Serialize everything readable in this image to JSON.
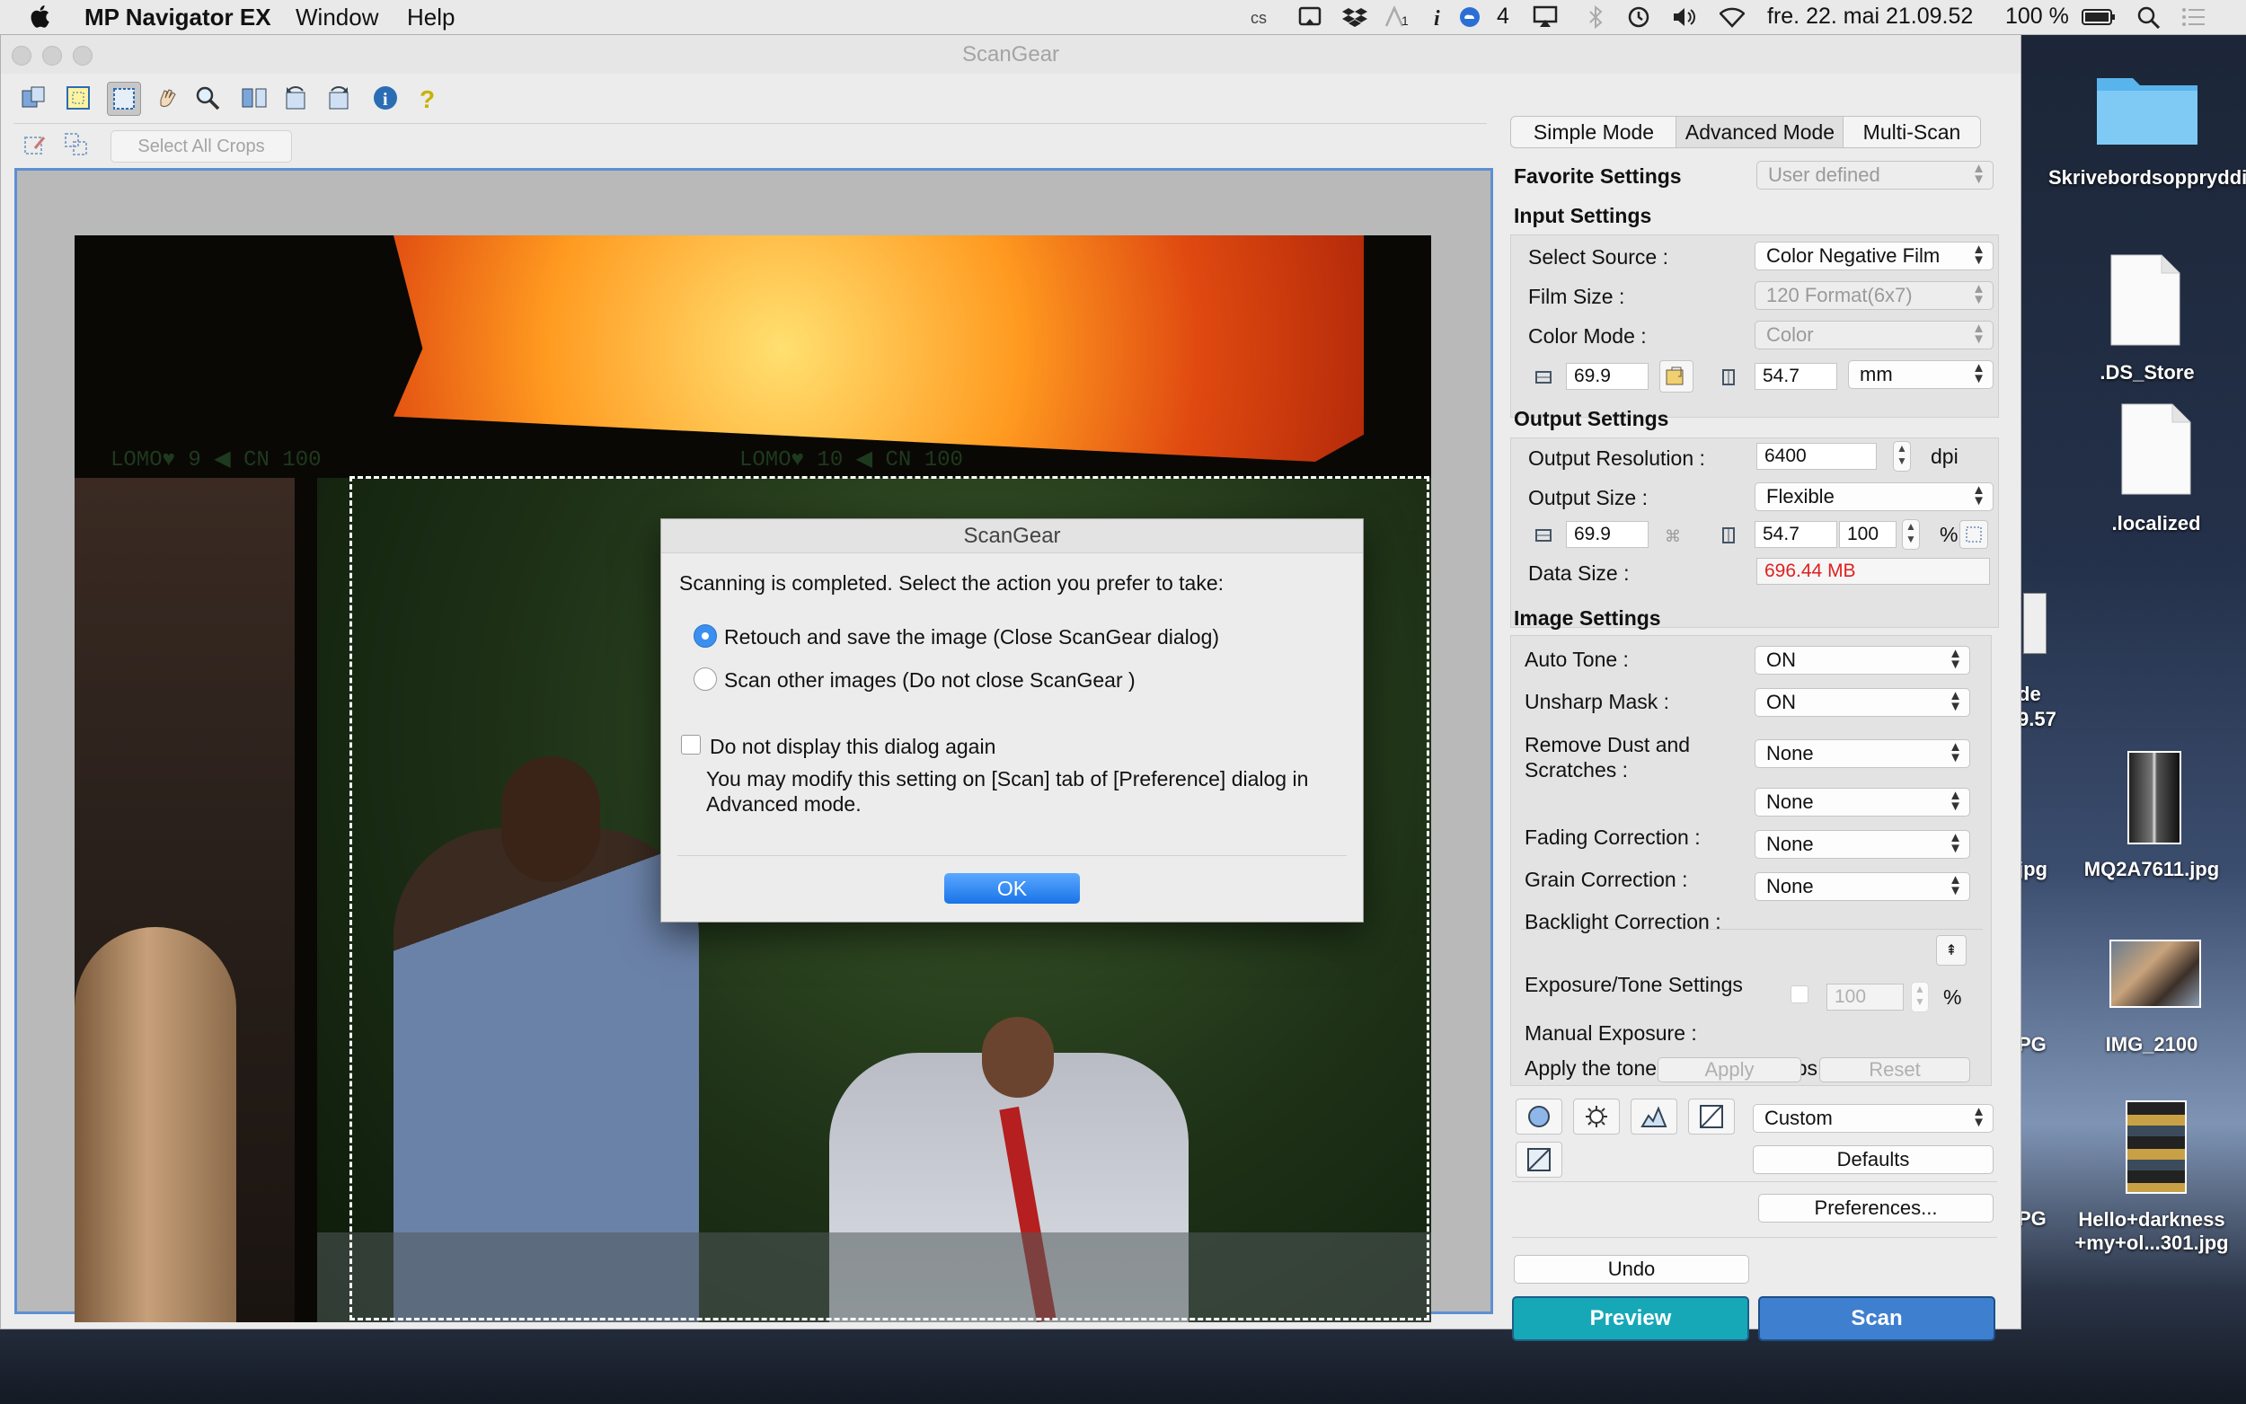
{
  "menubar": {
    "app_name": "MP Navigator EX",
    "menu_window": "Window",
    "menu_help": "Help",
    "cc_badge": "4",
    "date_time": "fre. 22. mai  21.09.52",
    "battery": "100 %"
  },
  "window": {
    "title": "ScanGear"
  },
  "toolbar": {
    "select_all_crops": "Select All Crops"
  },
  "film_edge_text": {
    "left": "LOMO♥    9   ◀  CN 100",
    "right": "LOMO♥  10   ◀  CN 100"
  },
  "modes": {
    "simple": "Simple Mode",
    "advanced": "Advanced Mode",
    "multi": "Multi-Scan"
  },
  "favorite": {
    "label": "Favorite Settings",
    "value": "User defined"
  },
  "input_settings": {
    "heading": "Input Settings",
    "select_source_label": "Select Source :",
    "select_source_value": "Color Negative Film",
    "film_size_label": "Film Size :",
    "film_size_value": "120 Format(6x7)",
    "color_mode_label": "Color Mode :",
    "color_mode_value": "Color",
    "width": "69.9",
    "height": "54.7",
    "unit": "mm"
  },
  "output_settings": {
    "heading": "Output Settings",
    "resolution_label": "Output Resolution :",
    "resolution_value": "6400",
    "resolution_unit": "dpi",
    "size_label": "Output Size :",
    "size_value": "Flexible",
    "width": "69.9",
    "height": "54.7",
    "scale": "100",
    "scale_unit": "%",
    "data_size_label": "Data Size :",
    "data_size_value": "696.44 MB"
  },
  "image_settings": {
    "heading": "Image Settings",
    "auto_tone_label": "Auto Tone :",
    "auto_tone_value": "ON",
    "unsharp_label": "Unsharp Mask :",
    "unsharp_value": "ON",
    "dust_label": "Remove Dust and Scratches :",
    "dust_value": "None",
    "fading_label": "Fading Correction :",
    "fading_value": "None",
    "grain_label": "Grain Correction :",
    "grain_value": "None",
    "backlight_label": "Backlight Correction :",
    "backlight_value": "None",
    "exposure_heading": "Exposure/Tone Settings",
    "manual_exposure_label": "Manual Exposure :",
    "manual_exposure_value": "100",
    "manual_exposure_unit": "%",
    "apply_tone_label": "Apply the tone value to all crops :",
    "apply_btn": "Apply",
    "reset_btn": "Reset"
  },
  "adjust": {
    "preset": "Custom",
    "defaults_btn": "Defaults",
    "preferences_btn": "Preferences..."
  },
  "actions": {
    "undo": "Undo",
    "preview": "Preview",
    "scan": "Scan",
    "preview_color": "#17a8b8",
    "scan_color": "#3f7fd0"
  },
  "dialog": {
    "title": "ScanGear",
    "message": "Scanning is completed. Select the action you prefer to take:",
    "option1": "Retouch and save the image (Close ScanGear dialog)",
    "option2": "Scan other images (Do not close ScanGear )",
    "checkbox": "Do not display this dialog again",
    "note_line1": "You may modify this setting on [Scan] tab of  [Preference] dialog in",
    "note_line2": "Advanced mode.",
    "ok": "OK"
  },
  "desktop": {
    "folder": "Skrivebordsopprydding",
    "file1": ".DS_Store",
    "file2": ".localized",
    "img1": "MQ2A7611.jpg",
    "img2": "IMG_2100",
    "img3": "Hello+darkness +my+ol...301.jpg",
    "partial1": "de",
    "partial2": "9.57",
    "partial3": "jpg",
    "partial4": "PG",
    "partial5": "PG"
  }
}
